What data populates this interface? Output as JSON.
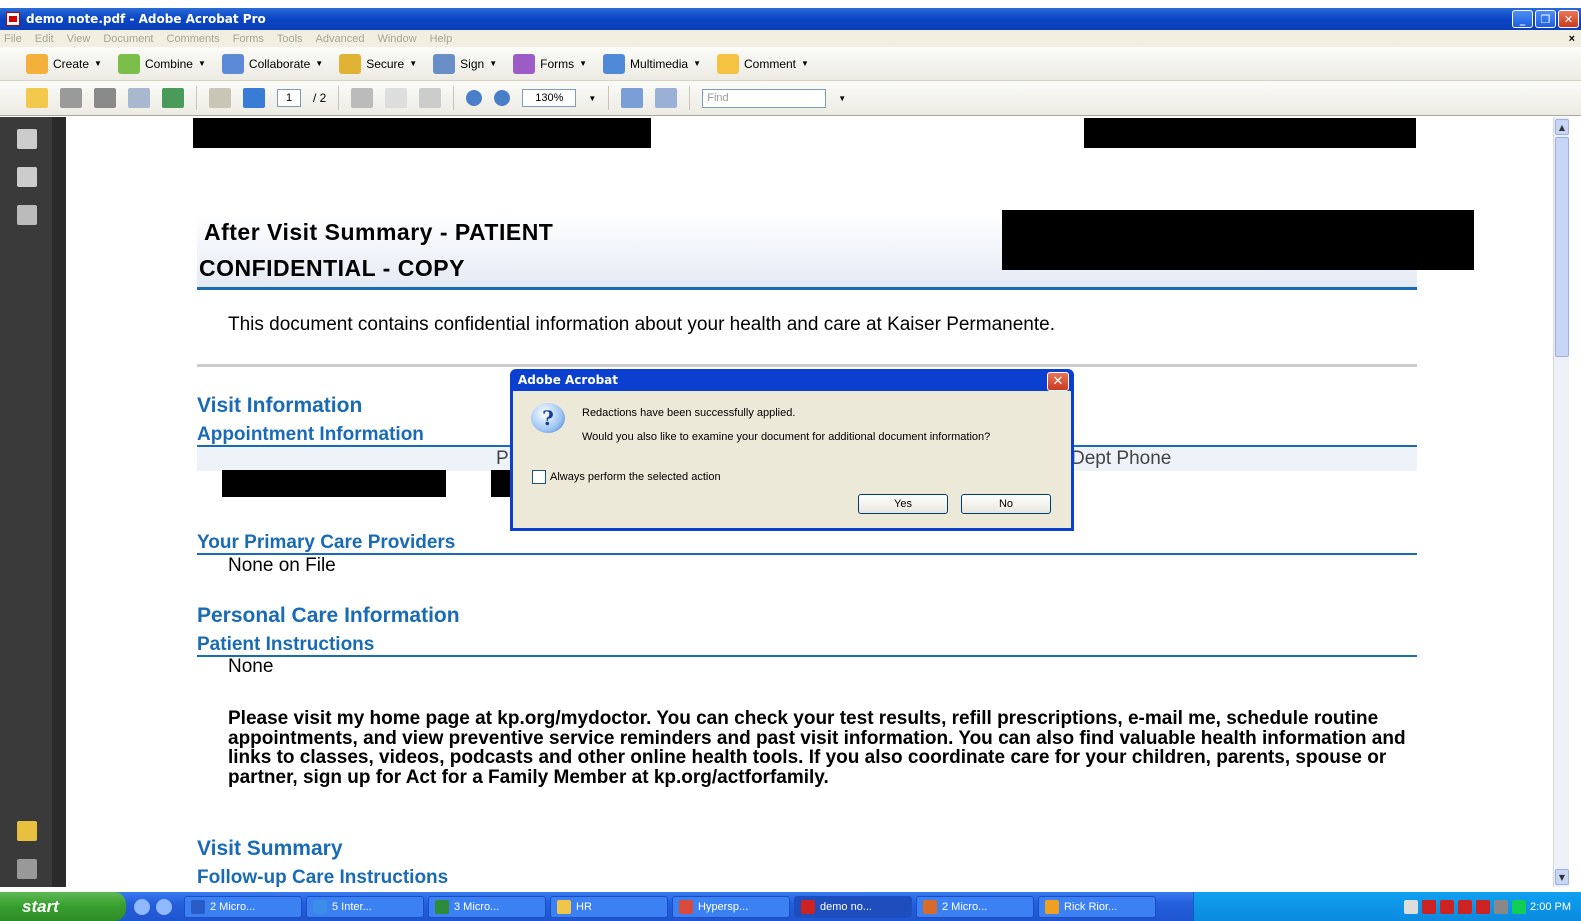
{
  "window": {
    "title": "demo note.pdf - Adobe Acrobat Pro"
  },
  "menu": [
    "File",
    "Edit",
    "View",
    "Document",
    "Comments",
    "Forms",
    "Tools",
    "Advanced",
    "Window",
    "Help"
  ],
  "toolbar1": [
    {
      "label": "Create",
      "icon": "create-icon",
      "color": "#f3b13b"
    },
    {
      "label": "Combine",
      "icon": "combine-icon",
      "color": "#7bbf4a"
    },
    {
      "label": "Collaborate",
      "icon": "collaborate-icon",
      "color": "#5d8ad6"
    },
    {
      "label": "Secure",
      "icon": "lock-icon",
      "color": "#e1b334"
    },
    {
      "label": "Sign",
      "icon": "pen-icon",
      "color": "#6a8ec8"
    },
    {
      "label": "Forms",
      "icon": "forms-icon",
      "color": "#9b5cc6"
    },
    {
      "label": "Multimedia",
      "icon": "multimedia-icon",
      "color": "#4f8ad8"
    },
    {
      "label": "Comment",
      "icon": "comment-icon",
      "color": "#f5c242"
    }
  ],
  "toolbar2": {
    "page_current": "1",
    "page_total": "/ 2",
    "zoom": "130%",
    "find_placeholder": "Find"
  },
  "document": {
    "title_line1": "After Visit Summary - PATIENT",
    "title_line2": "CONFIDENTIAL - COPY",
    "intro": "This document contains confidential information about your health and care at Kaiser Permanente.",
    "visit_info": "Visit Information",
    "appointment_info": "Appointment Information",
    "col_p": "P",
    "col_dept_phone": "Dept Phone",
    "pcp_heading": "Your Primary Care Providers",
    "pcp_value": "None on File",
    "personal_care": "Personal Care Information",
    "patient_instructions": "Patient Instructions",
    "instructions_value": "None",
    "paragraph": "Please visit my home page at kp.org/mydoctor. You can check your test results, refill prescriptions, e-mail me, schedule routine appointments, and view preventive service reminders and past visit information. You can also find valuable health information and links to classes, videos, podcasts and other online health tools. If you also coordinate care for your children, parents, spouse or partner, sign up for Act for a Family Member at kp.org/actforfamily.",
    "visit_summary": "Visit Summary",
    "followup": "Follow-up Care Instructions"
  },
  "dialog": {
    "title": "Adobe Acrobat",
    "line1": "Redactions have been successfully applied.",
    "line2": "Would you also like to examine your document for additional document information?",
    "checkbox_label": "Always perform the selected action",
    "yes": "Yes",
    "no": "No"
  },
  "taskbar": {
    "start": "start",
    "tasks": [
      {
        "label": "2 Micro...",
        "color": "#2a5cc8"
      },
      {
        "label": "5 Inter...",
        "color": "#3a8ee8"
      },
      {
        "label": "3 Micro...",
        "color": "#2e8b3a"
      },
      {
        "label": "HR",
        "color": "#f0c64a"
      },
      {
        "label": "Hypersp...",
        "color": "#d84a3a"
      },
      {
        "label": "demo no...",
        "color": "#cc2222"
      },
      {
        "label": "2 Micro...",
        "color": "#d86a2a"
      },
      {
        "label": "Rick Rior...",
        "color": "#f0a020"
      }
    ],
    "clock": "2:00 PM"
  }
}
